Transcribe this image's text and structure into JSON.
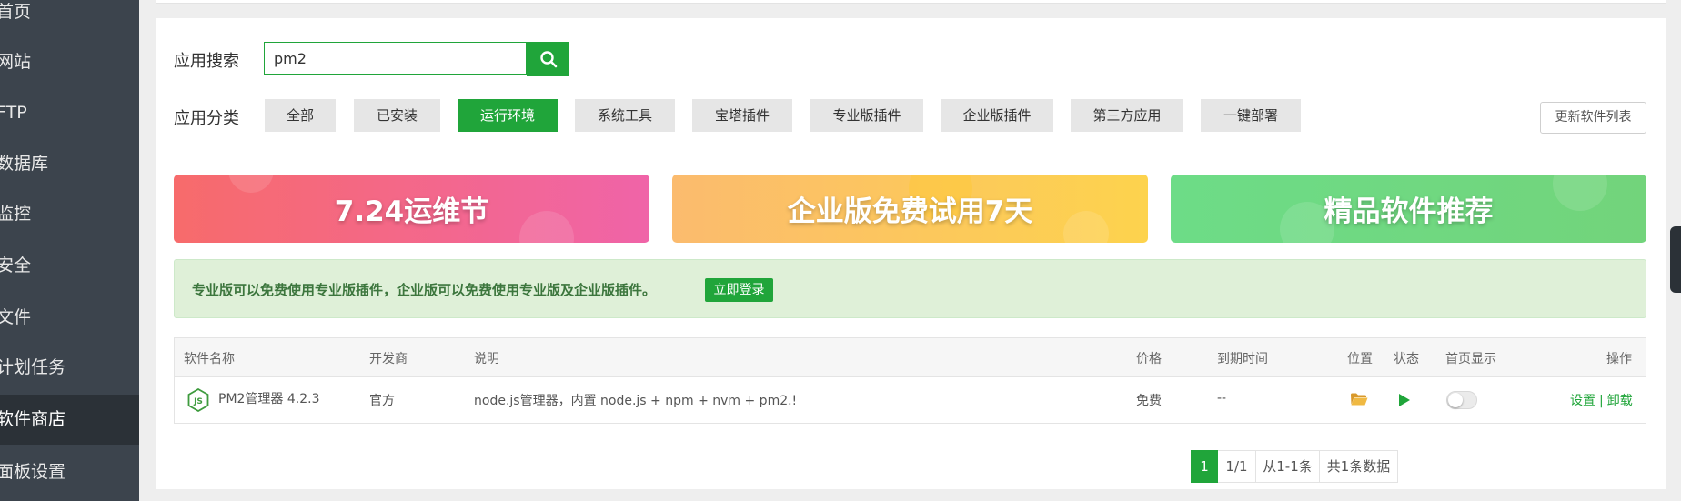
{
  "sidebar": {
    "items": [
      {
        "label": "首页"
      },
      {
        "label": "网站"
      },
      {
        "label": "FTP"
      },
      {
        "label": "数据库"
      },
      {
        "label": "监控"
      },
      {
        "label": "安全"
      },
      {
        "label": "文件"
      },
      {
        "label": "计划任务"
      },
      {
        "label": "软件商店",
        "active": true
      },
      {
        "label": "面板设置"
      }
    ]
  },
  "search": {
    "label": "应用搜索",
    "value": "pm2"
  },
  "categories": {
    "label": "应用分类",
    "items": [
      "全部",
      "已安装",
      "运行环境",
      "系统工具",
      "宝塔插件",
      "专业版插件",
      "企业版插件",
      "第三方应用",
      "一键部署"
    ],
    "active": "运行环境",
    "update_button": "更新软件列表"
  },
  "banners": [
    {
      "text": "7.24运维节",
      "colors": [
        "#f76b6b",
        "#f064a8"
      ]
    },
    {
      "text": "企业版免费试用7天",
      "colors": [
        "#fbbb6e",
        "#fdd34d"
      ]
    },
    {
      "text": "精品软件推荐",
      "colors": [
        "#6ddc87",
        "#72d47b"
      ]
    }
  ],
  "notice": {
    "text": "专业版可以免费使用专业版插件，企业版可以免费使用专业版及企业版插件。",
    "button": "立即登录"
  },
  "table": {
    "headers": {
      "name": "软件名称",
      "developer": "开发商",
      "description": "说明",
      "price": "价格",
      "expire": "到期时间",
      "location": "位置",
      "status": "状态",
      "home_display": "首页显示",
      "actions": "操作"
    },
    "rows": [
      {
        "icon": "nodejs-icon",
        "name": "PM2管理器 4.2.3",
        "developer": "官方",
        "description": "node.js管理器，内置 node.js + npm + nvm + pm2.!",
        "price": "免费",
        "expire": "--",
        "home_display": false,
        "action_settings": "设置",
        "action_separator": "|",
        "action_uninstall": "卸载"
      }
    ]
  },
  "pagination": {
    "current": "1",
    "pages": "1/1",
    "range": "从1-1条",
    "total": "共1条数据"
  },
  "colors": {
    "accent": "#20a53a",
    "sidebar_bg": "#3c444d",
    "sidebar_active": "#2b3137",
    "notice_bg": "#dff0d8",
    "notice_text": "#3c763d",
    "folder_icon": "#e5a831"
  }
}
